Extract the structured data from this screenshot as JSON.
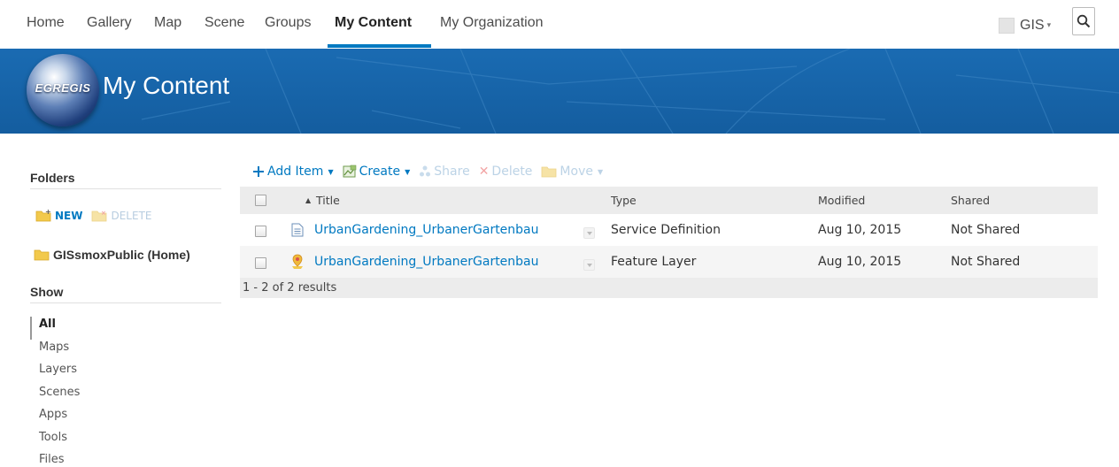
{
  "topnav": {
    "links": [
      "Home",
      "Gallery",
      "Map",
      "Scene",
      "Groups",
      "My Content",
      "My Organization"
    ],
    "active": "My Content",
    "user": {
      "name": "GIS",
      "caret": "▾"
    }
  },
  "banner": {
    "logo_text": "EGREGIS",
    "title": "My Content",
    "color": "#1a6bb2"
  },
  "sidebar": {
    "folders_heading": "Folders",
    "new_label": "NEW",
    "delete_label": "DELETE",
    "home_folder": "GISsmoxPublic (Home)",
    "show_heading": "Show",
    "show_items": [
      "All",
      "Maps",
      "Layers",
      "Scenes",
      "Apps",
      "Tools",
      "Files"
    ],
    "show_active": "All"
  },
  "toolbar": {
    "add_item": "Add Item",
    "create": "Create",
    "share": "Share",
    "delete": "Delete",
    "move": "Move"
  },
  "table": {
    "headers": {
      "sort_arrow": "▲",
      "title": "Title",
      "type": "Type",
      "modified": "Modified",
      "shared": "Shared"
    },
    "rows": [
      {
        "title": "UrbanGardening_UrbanerGartenbau",
        "type": "Service Definition",
        "modified": "Aug 10, 2015",
        "shared": "Not Shared",
        "icon": "document-icon"
      },
      {
        "title": "UrbanGardening_UrbanerGartenbau",
        "type": "Feature Layer",
        "modified": "Aug 10, 2015",
        "shared": "Not Shared",
        "icon": "feature-layer-icon"
      }
    ],
    "results": "1 - 2 of 2 results"
  },
  "colors": {
    "accent": "#0079c1",
    "banner": "#1a6bb2",
    "folder": "#f2c94c",
    "disabled": "#bcd3e6"
  }
}
